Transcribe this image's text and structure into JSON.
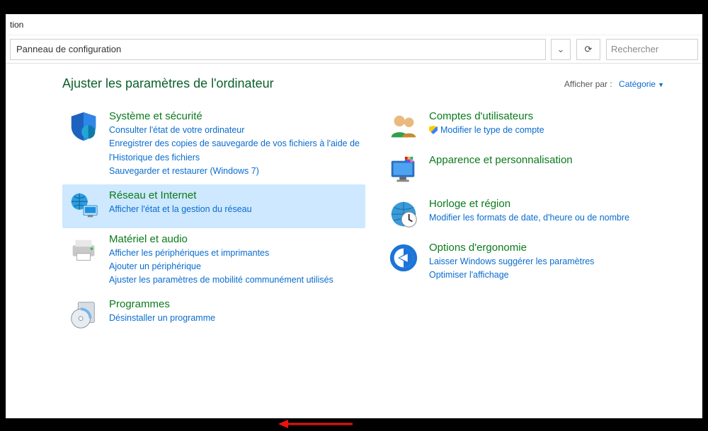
{
  "window": {
    "title_fragment": "tion"
  },
  "address_bar": {
    "breadcrumb": "Panneau de configuration",
    "search_placeholder": "Rechercher"
  },
  "header": {
    "title": "Ajuster les paramètres de l'ordinateur",
    "view_by_label": "Afficher par :",
    "view_by_value": "Catégorie"
  },
  "categories": {
    "system_security": {
      "title": "Système et sécurité",
      "links": [
        "Consulter l'état de votre ordinateur",
        "Enregistrer des copies de sauvegarde de vos fichiers à l'aide de l'Historique des fichiers",
        "Sauvegarder et restaurer (Windows 7)"
      ]
    },
    "network": {
      "title": "Réseau et Internet",
      "links": [
        "Afficher l'état et la gestion du réseau"
      ]
    },
    "hardware": {
      "title": "Matériel et audio",
      "links": [
        "Afficher les périphériques et imprimantes",
        "Ajouter un périphérique",
        "Ajuster les paramètres de mobilité communément utilisés"
      ]
    },
    "programs": {
      "title": "Programmes",
      "links": [
        "Désinstaller un programme"
      ]
    },
    "users": {
      "title": "Comptes d'utilisateurs",
      "links": [
        "Modifier le type de compte"
      ]
    },
    "appearance": {
      "title": "Apparence et personnalisation",
      "links": []
    },
    "clock": {
      "title": "Horloge et région",
      "links": [
        "Modifier les formats de date, d'heure ou de nombre"
      ]
    },
    "ease": {
      "title": "Options d'ergonomie",
      "links": [
        "Laisser Windows suggérer les paramètres",
        "Optimiser l'affichage"
      ]
    }
  },
  "annotation": {
    "arrow_target": "programs-uninstall-link",
    "arrow_color": "#e11"
  }
}
